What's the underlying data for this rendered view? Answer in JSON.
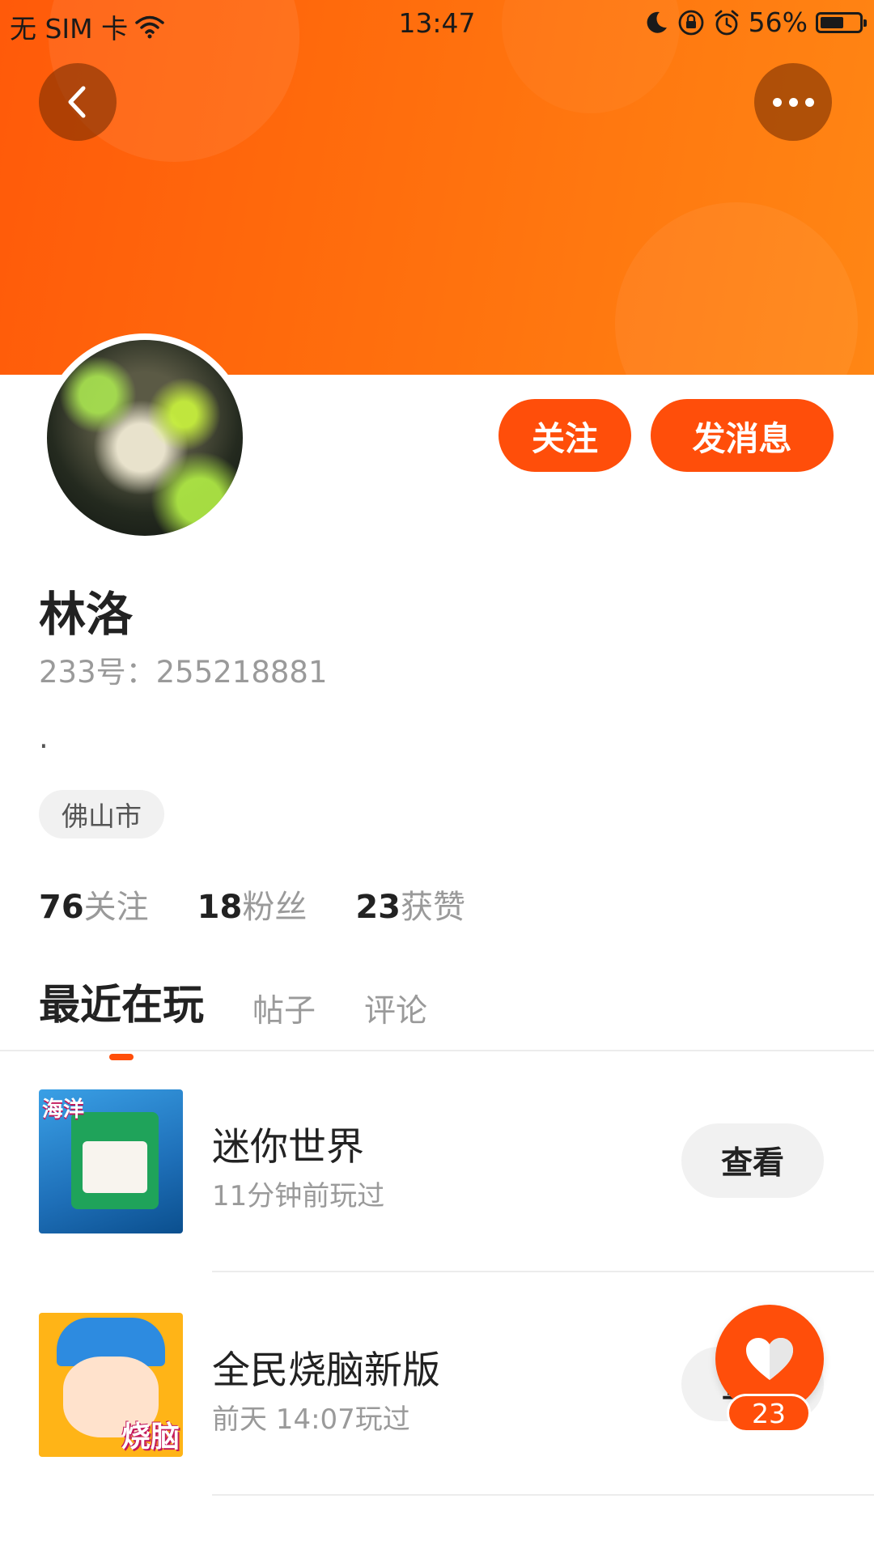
{
  "status_bar": {
    "carrier": "无 SIM 卡",
    "time": "13:47",
    "battery": "56%"
  },
  "profile": {
    "name": "林洛",
    "uid": "233号：255218881",
    "bio": ".",
    "city": "佛山市",
    "follow_label": "关注",
    "message_label": "发消息"
  },
  "stats": [
    {
      "value": "76",
      "label": "关注"
    },
    {
      "value": "18",
      "label": "粉丝"
    },
    {
      "value": "23",
      "label": "获赞"
    }
  ],
  "tabs": [
    {
      "label": "最近在玩",
      "active": true
    },
    {
      "label": "帖子",
      "active": false
    },
    {
      "label": "评论",
      "active": false
    }
  ],
  "games": [
    {
      "title": "迷你世界",
      "last_played": "11分钟前玩过",
      "action": "查看",
      "icon": "mini-world-icon",
      "icon_badge": "海洋"
    },
    {
      "title": "全民烧脑新版",
      "last_played": "前天 14:07玩过",
      "action": "查看",
      "icon": "brain-game-icon",
      "icon_badge": "烧脑"
    }
  ],
  "like_fab": {
    "count": "23"
  },
  "colors": {
    "accent": "#ff4e0a",
    "banner_start": "#ff5a0a",
    "banner_end": "#ff8614"
  }
}
